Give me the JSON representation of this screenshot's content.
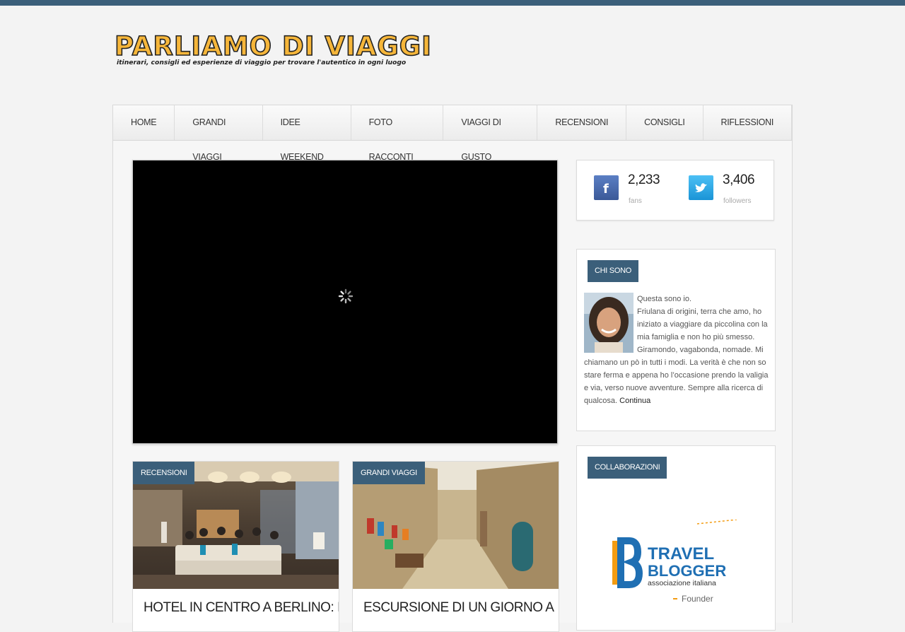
{
  "site": {
    "title": "PARLIAMO DI VIAGGI",
    "tagline": "itinerari, consigli ed esperienze di viaggio per trovare l'autentico in ogni luogo"
  },
  "colors": {
    "accent": "#3b5f7a",
    "logo": "#f6b63a",
    "facebook": "#3b5998",
    "twitter": "#1da1f2"
  },
  "nav": {
    "items": [
      {
        "label": "HOME"
      },
      {
        "label": "GRANDI VIAGGI"
      },
      {
        "label": "IDEE WEEKEND"
      },
      {
        "label": "FOTO RACCONTI"
      },
      {
        "label": "VIAGGI DI GUSTO"
      },
      {
        "label": "RECENSIONI"
      },
      {
        "label": "CONSIGLI"
      },
      {
        "label": "RIFLESSIONI"
      }
    ]
  },
  "video": {
    "state": "loading"
  },
  "posts": [
    {
      "category": "RECENSIONI",
      "title": "HOTEL IN CENTRO A BERLINO: IL"
    },
    {
      "category": "GRANDI VIAGGI",
      "title": "ESCURSIONE DI UN GIORNO A"
    }
  ],
  "social": {
    "facebook": {
      "count": "2,233",
      "label": "fans",
      "icon": "facebook-icon"
    },
    "twitter": {
      "count": "3,406",
      "label": "followers",
      "icon": "twitter-icon"
    }
  },
  "about": {
    "title": "CHI SONO",
    "intro": "Questa sono io.",
    "text": "Friulana di origini, terra che amo, ho iniziato a viaggiare da piccolina con la mia famiglia e non ho più smesso. Giramondo, vagabonda, nomade. Mi chiamano un pò in tutti i modi. La verità è che non so stare ferma e appena ho l’occasione prendo la valigia e via, verso nuove avventure. Sempre alla ricerca di qualcosa.",
    "link": "Continua"
  },
  "collab": {
    "title": "COLLABORAZIONI",
    "badge": {
      "brand": "TRAVEL BLOGGER",
      "sub": "associazione italiana",
      "role": "Founder"
    }
  }
}
